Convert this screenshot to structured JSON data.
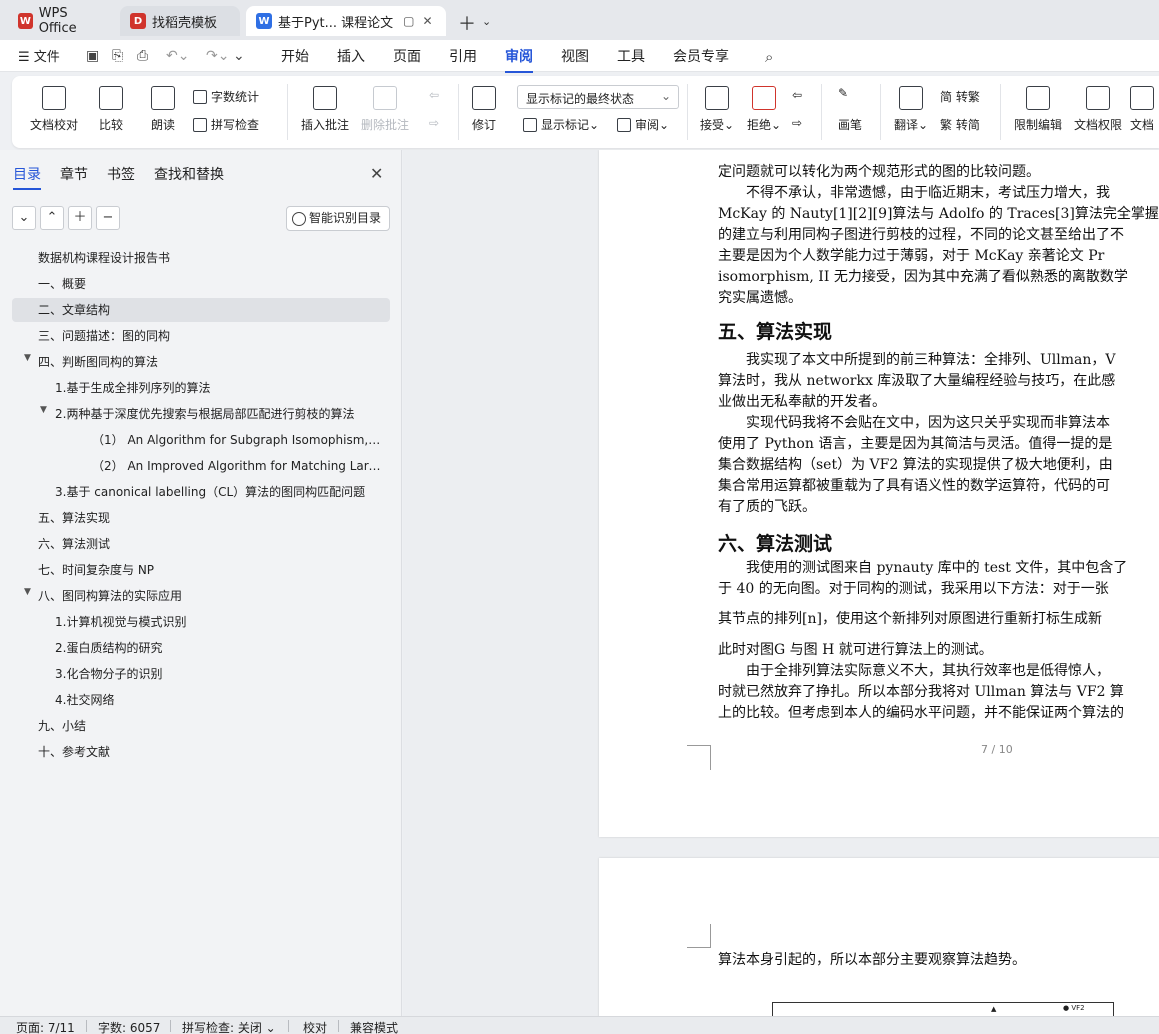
{
  "tabs": [
    {
      "label": "WPS Office",
      "color": "#d0342c"
    },
    {
      "label": "找稻壳模板",
      "color": "#d0342c"
    },
    {
      "label": "基于Pyt... 课程论文",
      "color": "#2f6fe4"
    }
  ],
  "menu": {
    "file": "文件",
    "items": [
      "开始",
      "插入",
      "页面",
      "引用",
      "审阅",
      "视图",
      "工具",
      "会员专享"
    ],
    "active": "审阅"
  },
  "ribbon": {
    "doc_check": "文档校对",
    "compare": "比较",
    "read_aloud": "朗读",
    "word_count": "字数统计",
    "spell_check": "拼写检查",
    "insert_comment": "插入批注",
    "delete_comment": "删除批注",
    "track_changes": "修订",
    "markup_select": "显示标记的最终状态",
    "show_markup": "显示标记",
    "review": "审阅",
    "accept": "接受",
    "reject": "拒绝",
    "pen": "画笔",
    "translate": "翻译",
    "to_traditional": "简 转繁",
    "to_simplified": "繁 转简",
    "restrict_edit": "限制编辑",
    "doc_permission": "文档权限",
    "doc_cut": "文档"
  },
  "nav": {
    "tabs": [
      "目录",
      "章节",
      "书签",
      "查找和替换"
    ],
    "smart_button": "智能识别目录",
    "toc": [
      "数据机构课程设计报告书",
      "一、概要",
      "二、文章结构",
      "三、问题描述：图的同构",
      "四、判断图同构的算法",
      "1.基于生成全排列序列的算法",
      "2.两种基于深度优先搜索与根据局部匹配进行剪枝的算法",
      "（1） An Algorithm for Subgraph Isomophism, J....",
      "（2） An Improved Algorithm for Matching Larg ...",
      "3.基于 canonical labelling（CL）算法的图同构匹配问题",
      "五、算法实现",
      "六、算法测试",
      "七、时间复杂度与 NP",
      "八、图同构算法的实际应用",
      "1.计算机视觉与模式识别",
      "2.蛋白质结构的研究",
      "3.化合物分子的识别",
      "4.社交网络",
      "九、小结",
      "十、参考文献"
    ]
  },
  "doc": {
    "p1": [
      "定问题就可以转化为两个规范形式的图的比较问题。",
      "　　不得不承认，非常遗憾，由于临近期末，考试压力增大，我",
      "McKay 的 Nauty[1][2][9]算法与 Adolfo 的 Traces[3]算法完全掌握",
      "的建立与利用同构子图进行剪枝的过程，不同的论文甚至给出了不",
      "主要是因为个人数学能力过于薄弱，对于 McKay 亲著论文 Pr",
      "isomorphism, II 无力接受，因为其中充满了看似熟悉的离散数学",
      "究实属遗憾。"
    ],
    "h5": "五、算法实现",
    "p2": [
      "　　我实现了本文中所提到的前三种算法：全排列、Ullman，V",
      "算法时，我从 networkx 库汲取了大量编程经验与技巧，在此感",
      "业做出无私奉献的开发者。",
      "　　实现代码我将不会贴在文中，因为这只关乎实现而非算法本",
      "使用了 Python 语言，主要是因为其简洁与灵活。值得一提的是",
      "集合数据结构（set）为 VF2 算法的实现提供了极大地便利，由",
      "集合常用运算都被重载为了具有语义性的数学运算符，代码的可",
      "有了质的飞跃。"
    ],
    "h6": "六、算法测试",
    "p3": [
      "　　我使用的测试图来自 pynauty 库中的 test 文件，其中包含了",
      "于 40 的无向图。对于同构的测试，我采用以下方法：对于一张",
      "其节点的排列[n]，使用这个新排列对原图进行重新打标生成新",
      "此时对图G 与图 H 就可进行算法上的测试。",
      "　　由于全排列算法实际意义不大，其执行效率也是低得惊人，",
      "时就已然放弃了挣扎。所以本部分我将对 Ullman 算法与 VF2 算",
      "上的比较。但考虑到本人的编码水平问题，并不能保证两个算法的"
    ],
    "page_number": "7 / 10",
    "page2_line": "算法本身引起的，所以本部分主要观察算法趋势。",
    "legend_vf2": "VF2"
  },
  "status": {
    "page": "页面: 7/11",
    "words": "字数: 6057",
    "spell": "拼写检查: 关闭",
    "proof": "校对",
    "compat": "兼容模式"
  }
}
